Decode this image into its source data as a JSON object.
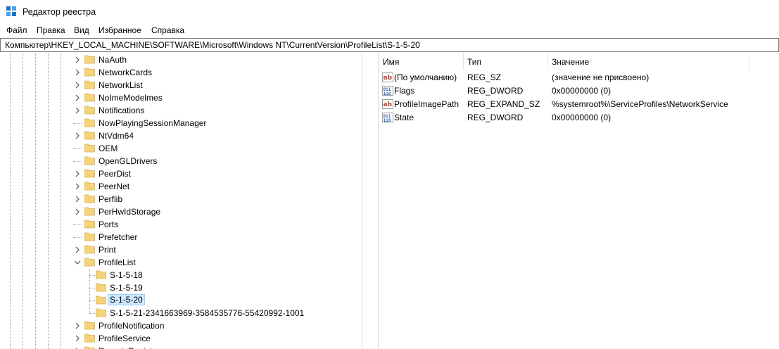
{
  "window": {
    "title": "Редактор реестра"
  },
  "menu": [
    "Файл",
    "Правка",
    "Вид",
    "Избранное",
    "Справка"
  ],
  "address": "Компьютер\\HKEY_LOCAL_MACHINE\\SOFTWARE\\Microsoft\\Windows NT\\CurrentVersion\\ProfileList\\S-1-5-20",
  "tree": [
    {
      "label": "NaAuth",
      "level": 1,
      "expander": "collapsed"
    },
    {
      "label": "NetworkCards",
      "level": 1,
      "expander": "collapsed"
    },
    {
      "label": "NetworkList",
      "level": 1,
      "expander": "collapsed"
    },
    {
      "label": "NoImeModelmes",
      "level": 1,
      "expander": "collapsed"
    },
    {
      "label": "Notifications",
      "level": 1,
      "expander": "collapsed"
    },
    {
      "label": "NowPlayingSessionManager",
      "level": 1,
      "expander": "none"
    },
    {
      "label": "NtVdm64",
      "level": 1,
      "expander": "collapsed"
    },
    {
      "label": "OEM",
      "level": 1,
      "expander": "none"
    },
    {
      "label": "OpenGLDrivers",
      "level": 1,
      "expander": "none"
    },
    {
      "label": "PeerDist",
      "level": 1,
      "expander": "collapsed"
    },
    {
      "label": "PeerNet",
      "level": 1,
      "expander": "collapsed"
    },
    {
      "label": "Perflib",
      "level": 1,
      "expander": "collapsed"
    },
    {
      "label": "PerHwIdStorage",
      "level": 1,
      "expander": "collapsed"
    },
    {
      "label": "Ports",
      "level": 1,
      "expander": "none"
    },
    {
      "label": "Prefetcher",
      "level": 1,
      "expander": "none"
    },
    {
      "label": "Print",
      "level": 1,
      "expander": "collapsed"
    },
    {
      "label": "ProfileList",
      "level": 1,
      "expander": "expanded"
    },
    {
      "label": "S-1-5-18",
      "level": 2,
      "expander": "none"
    },
    {
      "label": "S-1-5-19",
      "level": 2,
      "expander": "none"
    },
    {
      "label": "S-1-5-20",
      "level": 2,
      "expander": "none",
      "selected": true
    },
    {
      "label": "S-1-5-21-2341663969-3584535776-55420992-1001",
      "level": 2,
      "expander": "none"
    },
    {
      "label": "ProfileNotification",
      "level": 1,
      "expander": "collapsed"
    },
    {
      "label": "ProfileService",
      "level": 1,
      "expander": "collapsed"
    },
    {
      "label": "RemoteRegistry",
      "level": 1,
      "expander": "collapsed"
    }
  ],
  "list": {
    "columns": [
      "Имя",
      "Тип",
      "Значение"
    ],
    "rows": [
      {
        "name": "(По умолчанию)",
        "type": "REG_SZ",
        "data": "(значение не присвоено)",
        "icon": "string-value-icon"
      },
      {
        "name": "Flags",
        "type": "REG_DWORD",
        "data": "0x00000000 (0)",
        "icon": "binary-value-icon"
      },
      {
        "name": "ProfileImagePath",
        "type": "REG_EXPAND_SZ",
        "data": "%systemroot%\\ServiceProfiles\\NetworkService",
        "icon": "string-value-icon"
      },
      {
        "name": "State",
        "type": "REG_DWORD",
        "data": "0x00000000 (0)",
        "icon": "binary-value-icon"
      }
    ]
  },
  "colors": {
    "folder": "#f4d37a",
    "selection": "#cce8ff",
    "stringIcon": "#c0392b",
    "binaryIcon": "#2b5fa8"
  }
}
